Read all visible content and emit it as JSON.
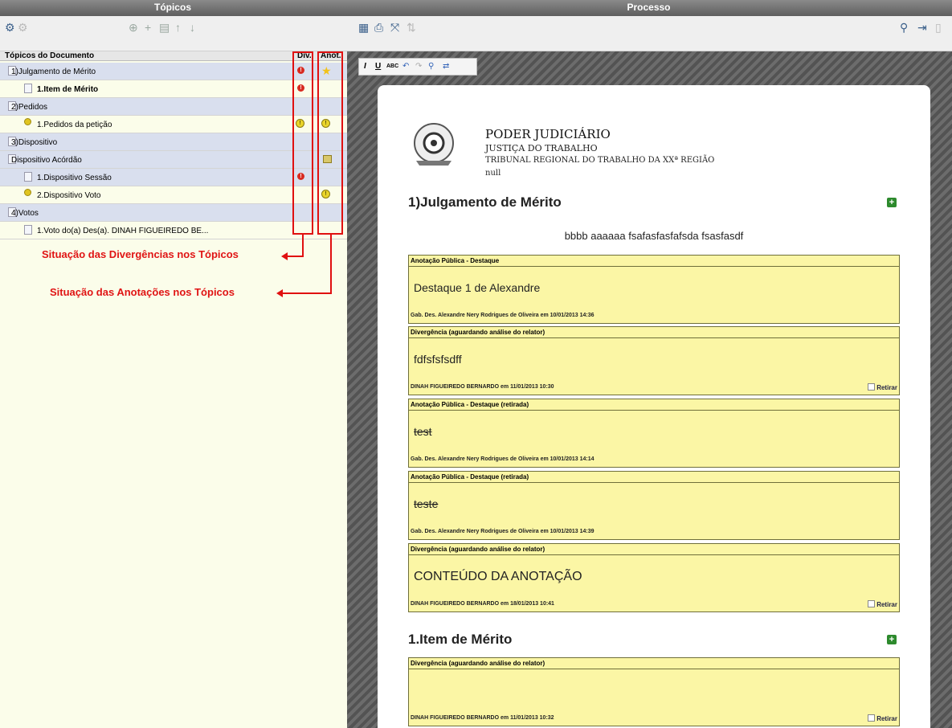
{
  "header": {
    "left_title": "Tópicos",
    "right_title": "Processo"
  },
  "toolbar": {
    "icons": [
      "gear-icon",
      "add-icon",
      "delete-icon",
      "up-icon",
      "down-icon",
      "save-icon",
      "print-icon",
      "expand-icon",
      "search-icon",
      "export-icon"
    ]
  },
  "topics": {
    "columns": {
      "name": "Tópicos do Documento",
      "div": "Div.",
      "anot": "Anot."
    },
    "rows": [
      {
        "label": "1)Julgamento de Mérito",
        "div": "red",
        "anot": "star"
      },
      {
        "label": "1.Item de Mérito",
        "div": "red",
        "anot": ""
      },
      {
        "label": "2)Pedidos",
        "div": "",
        "anot": ""
      },
      {
        "label": "1.Pedidos da petição",
        "div": "yellow",
        "anot": "yellow"
      },
      {
        "label": "3)Dispositivo",
        "div": "",
        "anot": ""
      },
      {
        "label": "Dispositivo Acórdão",
        "div": "",
        "anot": "note"
      },
      {
        "label": "1.Dispositivo Sessão",
        "div": "red",
        "anot": ""
      },
      {
        "label": "2.Dispositivo Voto",
        "div": "",
        "anot": "yellow"
      },
      {
        "label": "4)Votos",
        "div": "",
        "anot": ""
      },
      {
        "label": "1.Voto do(a) Des(a). DINAH FIGUEIREDO BE...",
        "div": "",
        "anot": ""
      }
    ]
  },
  "callouts": {
    "div": "Situação das Divergências nos Tópicos",
    "anot": "Situação das Anotações nos Tópicos"
  },
  "document": {
    "org1": "PODER JUDICIÁRIO",
    "org2": "JUSTIÇA DO TRABALHO",
    "org3": "TRIBUNAL REGIONAL DO TRABALHO DA XXª REGIÃO",
    "org4": "null",
    "section1": "1)Julgamento de Mérito",
    "body1": "bbbb aaaaaa fsafasfasfafsda fsasfasdf",
    "section2": "1.Item de Mérito",
    "retirar": "Retirar",
    "annotations": [
      {
        "header": "Anotação Pública - Destaque",
        "content": "Destaque 1 de Alexandre",
        "footer": "Gab. Des. Alexandre Nery Rodrigues de Oliveira em 10/01/2013 14:36"
      },
      {
        "header": "Divergência (aguardando análise do relator)",
        "content": "fdfsfsfsdff",
        "footer": "DINAH FIGUEIREDO BERNARDO em 11/01/2013 10:30"
      },
      {
        "header": "Anotação Pública - Destaque (retirada)",
        "content": "test",
        "footer": "Gab. Des. Alexandre Nery Rodrigues de Oliveira em 10/01/2013 14:14"
      },
      {
        "header": "Anotação Pública - Destaque (retirada)",
        "content": "teste",
        "footer": "Gab. Des. Alexandre Nery Rodrigues de Oliveira em 10/01/2013 14:39"
      },
      {
        "header": "Divergência (aguardando análise do relator)",
        "content": "CONTEÚDO DA ANOTAÇÃO",
        "footer": "DINAH FIGUEIREDO BERNARDO em 18/01/2013 10:41"
      },
      {
        "header": "Divergência (aguardando análise do relator)",
        "content": "",
        "footer": "DINAH FIGUEIREDO BERNARDO em 11/01/2013 10:32"
      }
    ]
  }
}
